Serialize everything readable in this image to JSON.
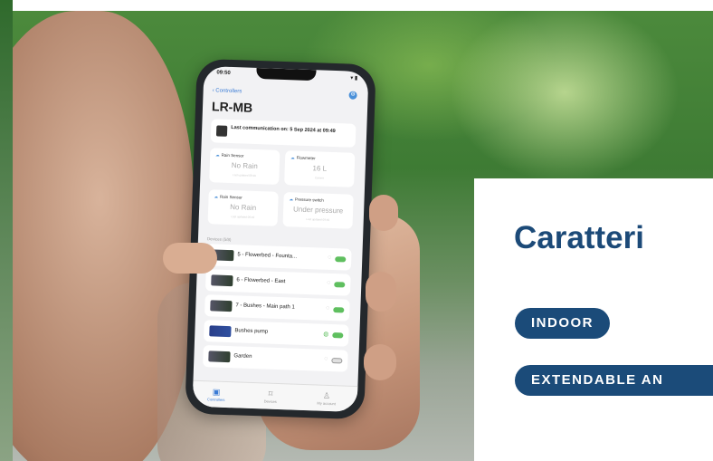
{
  "phone": {
    "status_time": "09:50",
    "status_icons": "▾ ▮",
    "back_label": "Controllers",
    "title": "LR-MB",
    "last_comm": "Last communication on: 5 Sep 2024 at 09:49",
    "cards": [
      {
        "label": "Rain Sensor",
        "value": "No Rain",
        "sub": "Last updated 09:49"
      },
      {
        "label": "Flowmeter",
        "value": "16 L",
        "sub": "Current"
      },
      {
        "label": "Rain Sensor",
        "value": "No Rain",
        "sub": "Last updated 09:49"
      },
      {
        "label": "Pressure switch",
        "value": "Under pressure",
        "sub": "Last updated 09:49"
      }
    ],
    "devices_header": "Devices (5/8)",
    "devices": [
      {
        "name": "5 - Flowerbed - Founta...",
        "on": true
      },
      {
        "name": "6 - Flowerbed - East",
        "on": true
      },
      {
        "name": "7 - Bushes - Main path 1",
        "on": true
      },
      {
        "name": "Bushes pump",
        "on": true
      },
      {
        "name": "Garden",
        "on": false
      }
    ],
    "tabs": [
      {
        "label": "Controllers",
        "icon": "controllers-icon",
        "glyph": "▣"
      },
      {
        "label": "Devices",
        "icon": "map-icon",
        "glyph": "⌑"
      },
      {
        "label": "My account",
        "icon": "account-icon",
        "glyph": "♙"
      }
    ]
  },
  "panel": {
    "heading": "Caratteri",
    "pills": [
      "INDOOR",
      "EXTENDABLE AN"
    ]
  },
  "colors": {
    "brand_blue": "#1b4b79",
    "heading_blue": "#1c4a78",
    "toggle_green": "#5fbf5f"
  }
}
